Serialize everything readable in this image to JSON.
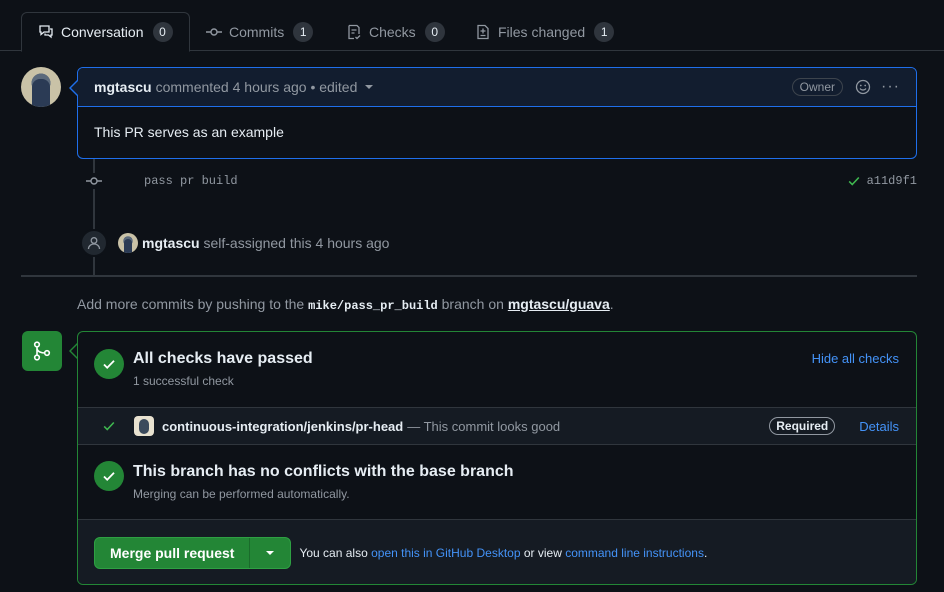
{
  "tabs": [
    {
      "label": "Conversation",
      "count": "0",
      "icon": "conversation-icon"
    },
    {
      "label": "Commits",
      "count": "1",
      "icon": "commit-icon"
    },
    {
      "label": "Checks",
      "count": "0",
      "icon": "checklist-icon"
    },
    {
      "label": "Files changed",
      "count": "1",
      "icon": "file-diff-icon"
    }
  ],
  "comment": {
    "author": "mgtascu",
    "meta": "commented 4 hours ago • edited",
    "badge": "Owner",
    "body": "This PR serves as an example"
  },
  "commit": {
    "message": "pass pr build",
    "sha": "a11d9f1",
    "status": "success"
  },
  "event": {
    "actor": "mgtascu",
    "text": "self-assigned this 4 hours ago"
  },
  "hint": {
    "prefix": "Add more commits by pushing to the",
    "branch": "mike/pass_pr_build",
    "middle": "branch on",
    "repo": "mgtascu/guava",
    "suffix": "."
  },
  "checks": {
    "title": "All checks have passed",
    "subtitle": "1 successful check",
    "hide_label": "Hide all checks",
    "item": {
      "name": "continuous-integration/jenkins/pr-head",
      "description": "— This commit looks good",
      "required_label": "Required",
      "details_label": "Details"
    }
  },
  "conflicts": {
    "title": "This branch has no conflicts with the base branch",
    "subtitle": "Merging can be performed automatically."
  },
  "merge": {
    "button_label": "Merge pull request",
    "also_prefix": "You can also",
    "desktop_link": "open this in GitHub Desktop",
    "or_view": "or view",
    "cli_link": "command line instructions",
    "suffix": "."
  },
  "colors": {
    "accent_blue": "#1f6feb",
    "success_green": "#238636",
    "background": "#0d1117"
  }
}
